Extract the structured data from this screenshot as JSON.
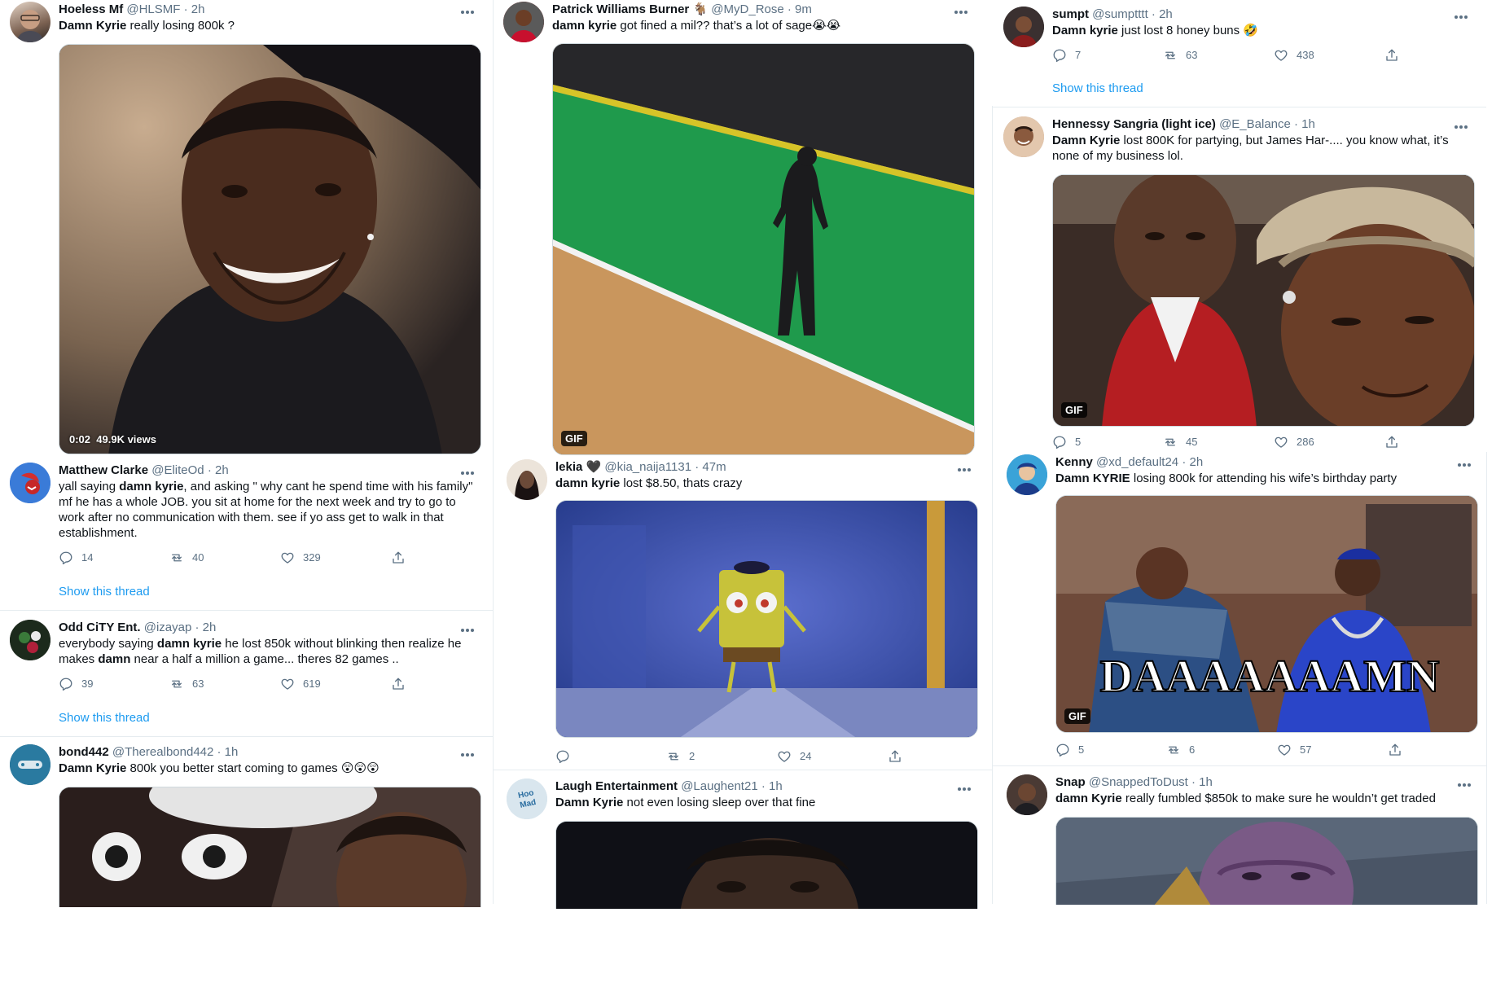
{
  "colors": {
    "text": "#0f1419",
    "muted": "#5b7083",
    "link": "#1d9bf0",
    "border": "#e6ecf0"
  },
  "icons": {
    "reply": "reply-icon",
    "retweet": "retweet-icon",
    "like": "heart-icon",
    "share": "share-icon",
    "more": "more-icon"
  },
  "tweets": {
    "hoeless": {
      "name": "Hoeless Mf",
      "handle": "@HLSMF",
      "time": "· 2h",
      "kw": "Damn Kyrie",
      "rest": " really losing 800k ?",
      "media_type": "video",
      "video_time": "0:02",
      "video_views": "49.9K views"
    },
    "patrick": {
      "name": "Patrick Williams Burner",
      "handle": "@MyD_Rose",
      "time": "· 9m",
      "kw": "damn kyrie",
      "rest": " got fined a mil?? that’s a lot of sage",
      "emoji": "😭😭",
      "badge": "GIF"
    },
    "sumpt": {
      "name": "sumpt",
      "handle": "@sumptttt",
      "time": "· 2h",
      "kw": "Damn kyrie",
      "rest": " just lost 8 honey buns",
      "emoji": "🤣",
      "replies": "7",
      "retweets": "63",
      "likes": "438",
      "show_thread": "Show this thread"
    },
    "hennessy": {
      "name": "Hennessy Sangria (light ice)",
      "handle": "@E_Balance",
      "time": "· 1h",
      "kw": "Damn Kyrie",
      "rest": " lost 800K for partying, but James Har-.... you know what, it’s none of my business lol.",
      "badge": "GIF",
      "replies": "5",
      "retweets": "45",
      "likes": "286"
    },
    "matthew": {
      "name": "Matthew Clarke",
      "handle": "@EliteOd",
      "time": "· 2h",
      "pre": "yall saying ",
      "kw": "damn kyrie",
      "rest": ", and asking \" why cant he spend time with his family\" mf he has a whole JOB. you sit at home for the next week and try to go to work after no communication with them. see if yo ass get to walk in that establishment.",
      "replies": "14",
      "retweets": "40",
      "likes": "329",
      "show_thread": "Show this thread"
    },
    "lekia": {
      "name": "lekia 🖤",
      "handle": "@kia_naija1131",
      "time": "· 47m",
      "kw": "damn kyrie",
      "rest": " lost $8.50, thats crazy",
      "replies": "",
      "retweets": "2",
      "likes": "24"
    },
    "kenny": {
      "name": "Kenny",
      "handle": "@xd_default24",
      "time": "· 2h",
      "kw": "Damn KYRIE",
      "rest": " losing 800k for attending his wife’s birthday party",
      "badge": "GIF",
      "caption": "DAAAAAAAMN",
      "replies": "5",
      "retweets": "6",
      "likes": "57"
    },
    "odd": {
      "name": "Odd CiTY Ent.",
      "handle": "@izayap",
      "time": "· 2h",
      "pre": "everybody saying ",
      "kw": "damn kyrie",
      "rest": " he lost 850k without blinking then realize he makes ",
      "kw2": "damn",
      "rest2": " near a half a million a game... theres 82 games ..",
      "replies": "39",
      "retweets": "63",
      "likes": "619",
      "show_thread": "Show this thread"
    },
    "laugh": {
      "name": "Laugh Entertainment",
      "handle": "@Laughent21",
      "time": "· 1h",
      "kw": "Damn Kyrie",
      "rest": " not even losing sleep over that fine"
    },
    "snap": {
      "name": "Snap",
      "handle": "@SnappedToDust",
      "time": "· 1h",
      "kw": "damn Kyrie",
      "rest": " really fumbled $850k to make sure he wouldn’t get traded"
    },
    "bond": {
      "name": "bond442",
      "handle": "@Therealbond442",
      "time": "· 1h",
      "kw": "Damn Kyrie",
      "rest": " 800k you better start coming to games",
      "emoji": "😲😲😲"
    }
  }
}
